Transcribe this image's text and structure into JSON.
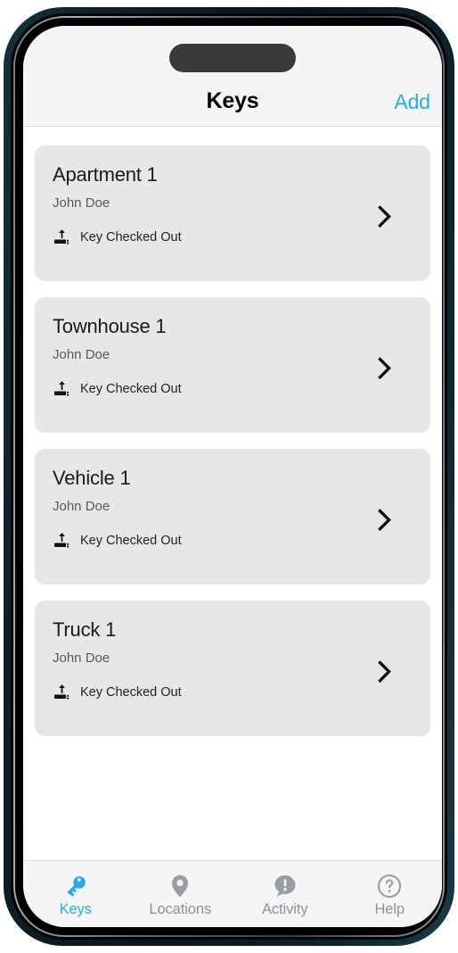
{
  "app": {
    "accent_color": "#29abe2",
    "card_color": "#e7e7e7",
    "header_color": "#f4f5f6",
    "inactive_tab_color": "#8e9194"
  },
  "header": {
    "title": "Keys",
    "add_label": "Add"
  },
  "keys": [
    {
      "title": "Apartment 1",
      "owner": "John Doe",
      "status": "Key Checked Out",
      "status_icon": "upload-dock-icon",
      "chevron_icon": "chevron-right-icon"
    },
    {
      "title": "Townhouse 1",
      "owner": "John Doe",
      "status": "Key Checked Out",
      "status_icon": "upload-dock-icon",
      "chevron_icon": "chevron-right-icon"
    },
    {
      "title": "Vehicle 1",
      "owner": "John Doe",
      "status": "Key Checked Out",
      "status_icon": "upload-dock-icon",
      "chevron_icon": "chevron-right-icon"
    },
    {
      "title": "Truck 1",
      "owner": "John Doe",
      "status": "Key Checked Out",
      "status_icon": "upload-dock-icon",
      "chevron_icon": "chevron-right-icon"
    }
  ],
  "tabs": [
    {
      "label": "Keys",
      "icon": "key-icon",
      "active": true
    },
    {
      "label": "Locations",
      "icon": "map-pin-icon",
      "active": false
    },
    {
      "label": "Activity",
      "icon": "alert-bubble-icon",
      "active": false
    },
    {
      "label": "Help",
      "icon": "question-circle-icon",
      "active": false
    }
  ]
}
